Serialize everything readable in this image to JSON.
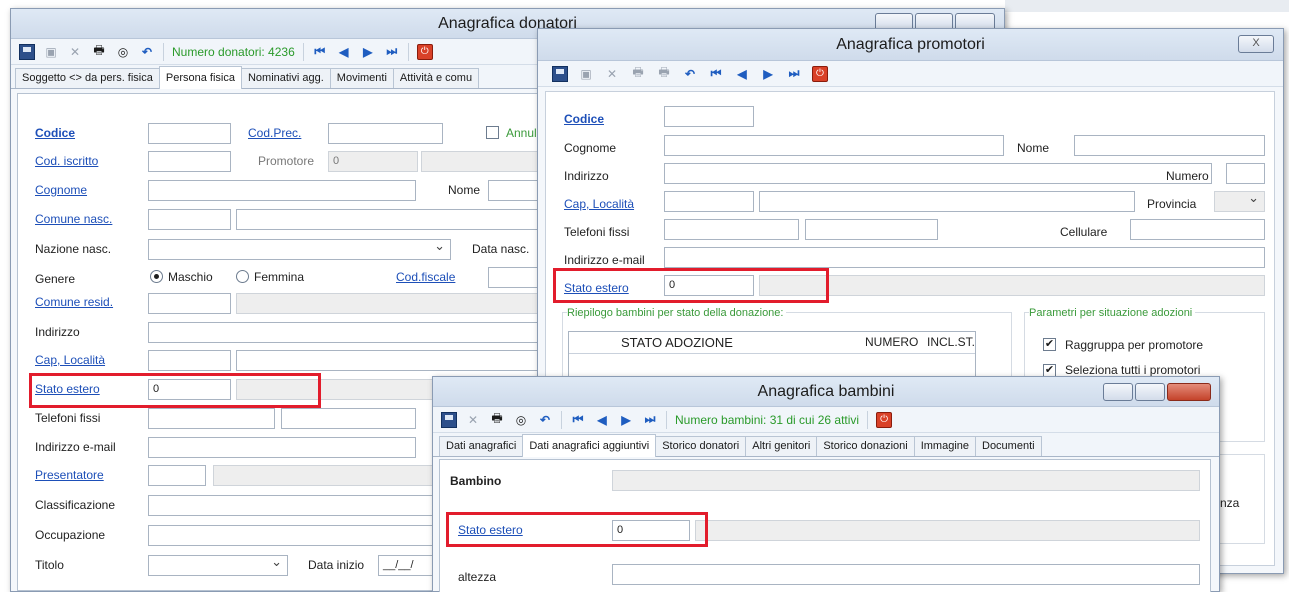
{
  "donatori": {
    "title": "Anagrafica donatori",
    "counter": "Numero donatori: 4236",
    "tabs": [
      "Soggetto <> da pers. fisica",
      "Persona fisica",
      "Nominativi agg.",
      "Movimenti",
      "Attività e comu"
    ],
    "labels": {
      "codice": "Codice",
      "cod_prec": "Cod.Prec.",
      "annull": "Annull.",
      "cod_iscritto": "Cod. iscritto",
      "promotore": "Promotore",
      "cognome": "Cognome",
      "nome": "Nome",
      "comune_nasc": "Comune nasc.",
      "nazione_nasc": "Nazione nasc.",
      "data_nasc": "Data nasc.",
      "genere": "Genere",
      "maschio": "Maschio",
      "femmina": "Femmina",
      "cod_fiscale": "Cod.fiscale",
      "comune_resid": "Comune resid.",
      "indirizzo": "Indirizzo",
      "cap_localita": "Cap, Località",
      "stato_estero": "Stato estero",
      "telefoni_fissi": "Telefoni fissi",
      "indirizzo_email": "Indirizzo e-mail",
      "presentatore": "Presentatore",
      "classificazione": "Classificazione",
      "occupazione": "Occupazione",
      "titolo": "Titolo",
      "data_inizio": "Data inizio"
    },
    "values": {
      "promotore": "0",
      "stato_estero": "0",
      "data_inizio": "__/__/"
    }
  },
  "promotori": {
    "title": "Anagrafica promotori",
    "close_label": "X",
    "labels": {
      "codice": "Codice",
      "cognome": "Cognome",
      "nome": "Nome",
      "indirizzo": "Indirizzo",
      "numero": "Numero",
      "cap_localita": "Cap, Località",
      "provincia": "Provincia",
      "telefoni_fissi": "Telefoni fissi",
      "cellulare": "Cellulare",
      "indirizzo_email": "Indirizzo e-mail",
      "stato_estero": "Stato estero"
    },
    "values": {
      "stato_estero": "0"
    },
    "riepilogo": {
      "title": "Riepilogo bambini per stato della donazione:",
      "col_stato": "STATO ADOZIONE",
      "col_numero": "NUMERO",
      "col_incl": "INCL.ST."
    },
    "parametri": {
      "title": "Parametri per situazione adozioni",
      "raggruppa": "Raggruppa per promotore",
      "seleziona": "Seleziona tutti i promotori",
      "partial": "nza"
    }
  },
  "bambini": {
    "title": "Anagrafica bambini",
    "counter": "Numero bambini: 31 di cui 26 attivi",
    "tabs": [
      "Dati anagrafici",
      "Dati anagrafici aggiuntivi",
      "Storico donatori",
      "Altri genitori",
      "Storico donazioni",
      "Immagine",
      "Documenti"
    ],
    "labels": {
      "bambino": "Bambino",
      "stato_estero": "Stato estero",
      "altezza": "altezza"
    },
    "values": {
      "stato_estero": "0"
    }
  },
  "colors": {
    "highlight": "#e21c2c",
    "link": "#1d4fb8",
    "counter": "#2a9a2a"
  }
}
